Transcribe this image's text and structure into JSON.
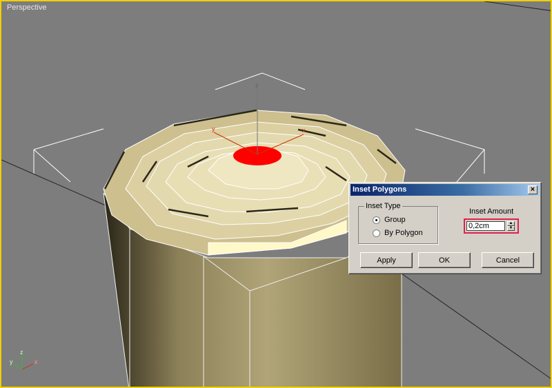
{
  "viewport": {
    "label": "Perspective",
    "border_color": "#f0d000",
    "selected_polygon_color": "#ff0000"
  },
  "axis_tripod": {
    "x": "x",
    "y": "y",
    "z": "z"
  },
  "gizmo": {
    "x": "x",
    "y": "y",
    "z": "z"
  },
  "dialog": {
    "title": "Inset Polygons",
    "close_icon": "close-icon",
    "inset_type": {
      "legend": "Inset Type",
      "options": [
        {
          "label": "Group",
          "selected": true
        },
        {
          "label": "By Polygon",
          "selected": false
        }
      ]
    },
    "inset_amount": {
      "label": "Inset Amount",
      "value": "0,2cm",
      "highlight_color": "#e0204a"
    },
    "buttons": {
      "apply": "Apply",
      "ok": "OK",
      "cancel": "Cancel"
    }
  }
}
